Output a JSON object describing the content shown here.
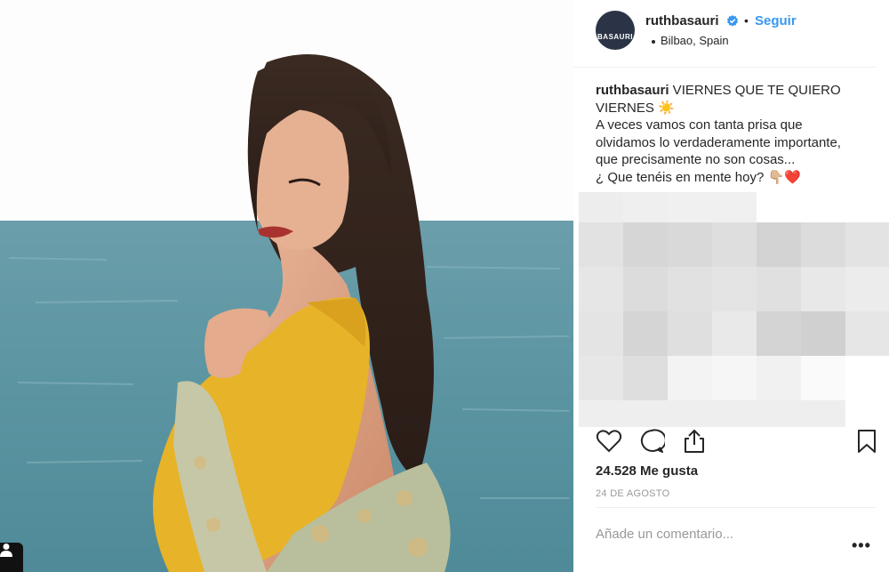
{
  "post": {
    "username": "ruthbasauri",
    "follow_label": "Seguir",
    "dot_separator": "•",
    "location": "Bilbao, Spain",
    "avatar_text": "BASAURI",
    "caption": {
      "username": "ruthbasauri",
      "text": " VIERNES QUE TE QUIERO VIERNES ☀️\nA veces vamos con tanta prisa que olvidamos lo verdaderamente importante, que precisamente no son cosas...\n¿ Que tenéis en mente hoy? 👇🏼❤️"
    },
    "likes": "24.528 Me gusta",
    "date": "24 DE AGOSTO",
    "comment_placeholder": "Añade un comentario...",
    "more_label": "•••"
  },
  "icons": {
    "like": "heart-icon",
    "comment": "comment-bubble-icon",
    "share": "share-icon",
    "save": "bookmark-icon",
    "verified": "verified-badge-icon",
    "tagged_user": "user-tag-icon"
  },
  "colors": {
    "link_blue": "#3897f0",
    "verified_blue": "#3897f0",
    "text": "#262626",
    "muted": "#999999",
    "divider": "#efefef"
  }
}
